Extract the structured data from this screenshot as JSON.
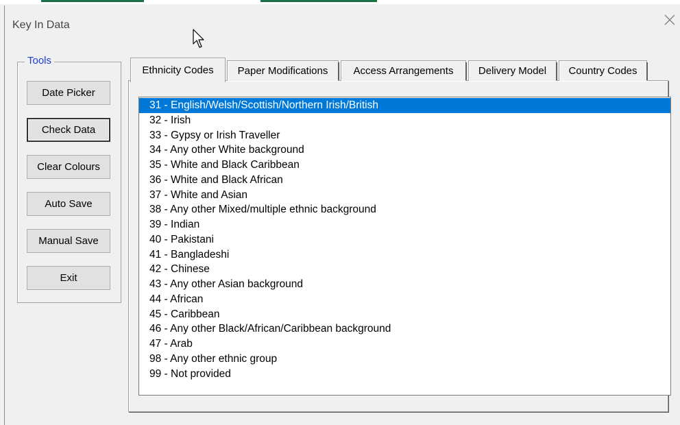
{
  "window": {
    "title": "Key In Data"
  },
  "tools": {
    "legend": "Tools",
    "buttons": [
      "Date Picker",
      "Check Data",
      "Clear Colours",
      "Auto Save",
      "Manual Save",
      "Exit"
    ]
  },
  "tabs": [
    "Ethnicity Codes",
    "Paper Modifications",
    "Access Arrangements",
    "Delivery Model",
    "Country Codes"
  ],
  "selected_tab": "Ethnicity Codes",
  "ethnicity_list": {
    "selected": "31 - English/Welsh/Scottish/Northern Irish/British",
    "items": [
      "31 - English/Welsh/Scottish/Northern Irish/British",
      "32 - Irish",
      "33 - Gypsy or Irish Traveller",
      "34 - Any other White background",
      "35 - White and Black Caribbean",
      "36 - White and Black African",
      "37 - White and Asian",
      "38 - Any other Mixed/multiple ethnic background",
      "39 - Indian",
      "40 - Pakistani",
      "41 - Bangladeshi",
      "42 - Chinese",
      "43 - Any other Asian background",
      "44 - African",
      "45 - Caribbean",
      "46 - Any other Black/African/Caribbean background",
      "47 - Arab",
      "98 - Any other ethnic group",
      "99 - Not provided"
    ]
  },
  "colors": {
    "selection": "#0078d7",
    "legend": "#1a3fd0",
    "excel_green": "#1e7145"
  },
  "icons": {
    "close": "close-icon",
    "cursor": "mouse-pointer-icon"
  }
}
